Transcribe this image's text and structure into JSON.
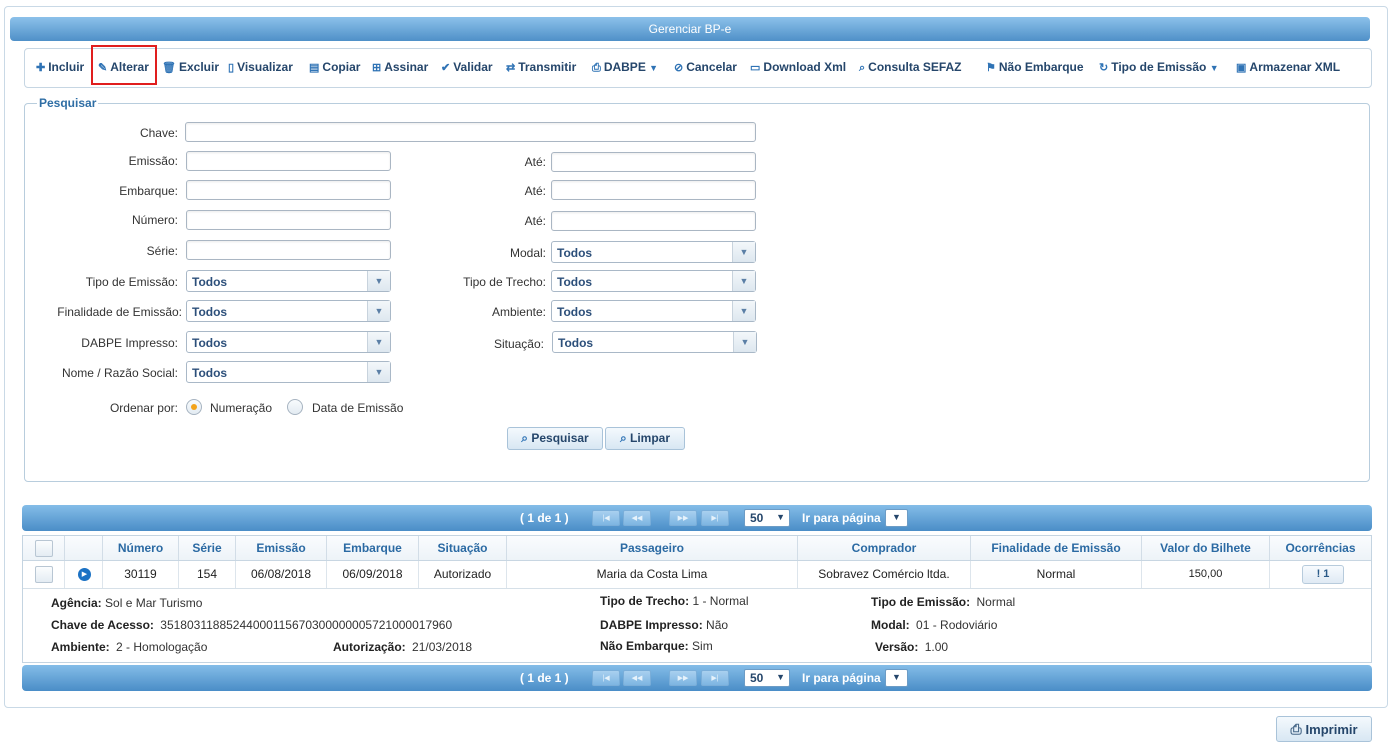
{
  "window": {
    "title": "Gerenciar BP-e"
  },
  "toolbar": {
    "items": [
      {
        "label": "Incluir",
        "icon": "plus-icon"
      },
      {
        "label": "Alterar",
        "icon": "pencil-icon"
      },
      {
        "label": "Excluir",
        "icon": "trash-icon"
      },
      {
        "label": "Visualizar",
        "icon": "document-icon"
      },
      {
        "label": "Copiar",
        "icon": "clipboard-icon"
      },
      {
        "label": "Assinar",
        "icon": "signature-icon"
      },
      {
        "label": "Validar",
        "icon": "check-icon"
      },
      {
        "label": "Transmitir",
        "icon": "transfer-icon"
      },
      {
        "label": "DABPE",
        "icon": "print-icon"
      },
      {
        "label": "Cancelar",
        "icon": "cancel-icon"
      },
      {
        "label": "Download Xml",
        "icon": "folder-icon"
      },
      {
        "label": "Consulta SEFAZ",
        "icon": "search-icon"
      },
      {
        "label": "Não Embarque",
        "icon": "flag-icon"
      },
      {
        "label": "Tipo de Emissão",
        "icon": "refresh-icon"
      },
      {
        "label": "Armazenar XML",
        "icon": "disk-icon"
      }
    ]
  },
  "search": {
    "legend": "Pesquisar",
    "labels": {
      "chave": "Chave:",
      "emissao": "Emissão:",
      "embarque": "Embarque:",
      "numero": "Número:",
      "serie": "Série:",
      "ate": "Até:",
      "modal": "Modal:",
      "tipo_emissao": "Tipo de Emissão:",
      "tipo_trecho": "Tipo de Trecho:",
      "finalidade": "Finalidade de Emissão:",
      "ambiente": "Ambiente:",
      "dabpe_impresso": "DABPE Impresso:",
      "situacao": "Situação:",
      "nome": "Nome / Razão Social:",
      "ordenar": "Ordenar por:"
    },
    "selects": {
      "modal": "Todos",
      "tipo_emissao": "Todos",
      "tipo_trecho": "Todos",
      "finalidade": "Todos",
      "ambiente": "Todos",
      "dabpe_impresso": "Todos",
      "situacao": "Todos",
      "nome": "Todos"
    },
    "order_options": [
      "Numeração",
      "Data de Emissão"
    ],
    "order_selected": "Numeração",
    "buttons": {
      "search": "Pesquisar",
      "clear": "Limpar"
    }
  },
  "pager": {
    "page_info": "( 1 de 1 )",
    "page_size": "50",
    "goto_label": "Ir para página",
    "icons": {
      "first": "first-page-icon",
      "prev": "prev-page-icon",
      "next": "next-page-icon",
      "last": "last-page-icon"
    }
  },
  "table": {
    "columns": [
      "Número",
      "Série",
      "Emissão",
      "Embarque",
      "Situação",
      "Passageiro",
      "Comprador",
      "Finalidade de Emissão",
      "Valor do Bilhete",
      "Ocorrências"
    ],
    "rows": [
      {
        "numero": "30119",
        "serie": "154",
        "emissao": "06/08/2018",
        "embarque": "06/09/2018",
        "situacao": "Autorizado",
        "passageiro": "Maria da Costa Lima",
        "comprador": "Sobravez Comércio ltda.",
        "finalidade": "Normal",
        "valor": "150,00",
        "ocorrencias": "1"
      }
    ],
    "detail": {
      "agencia_label": "Agência:",
      "agencia": "Sol e Mar Turismo",
      "chave_label": "Chave de Acesso:",
      "chave": "35180311885244000115670300000005721000017960",
      "ambiente_label": "Ambiente:",
      "ambiente": "2 - Homologação",
      "autorizacao_label": "Autorização:",
      "autorizacao": "21/03/2018",
      "tipo_trecho_label": "Tipo de Trecho:",
      "tipo_trecho": "1 - Normal",
      "dabpe_label": "DABPE Impresso:",
      "dabpe": "Não",
      "nao_embarque_label": "Não Embarque:",
      "nao_embarque": "Sim",
      "tipo_emissao_label": "Tipo de Emissão:",
      "tipo_emissao": "Normal",
      "modal_label": "Modal:",
      "modal": "01 - Rodoviário",
      "versao_label": "Versão:",
      "versao": "1.00"
    }
  },
  "footer": {
    "print": "Imprimir"
  },
  "colors": {
    "accent": "#4f90c8",
    "highlight": "#e01e1e",
    "radio_selected": "#f3a31a"
  }
}
